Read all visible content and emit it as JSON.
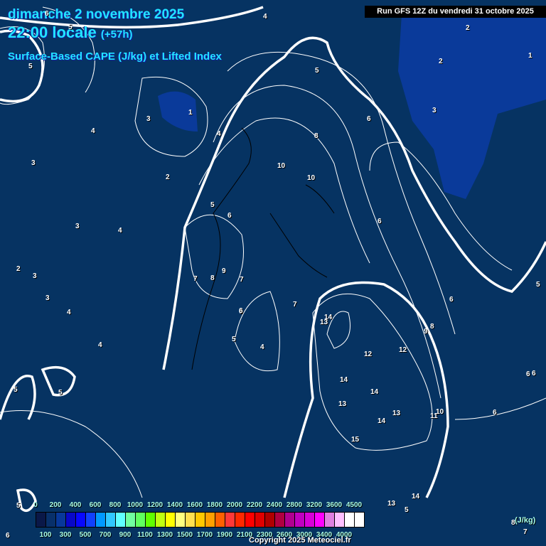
{
  "header": {
    "date": "dimanche 2 novembre 2025",
    "time": "22:00 locale",
    "lead": "(+57h)",
    "parameter": "Surface-Based CAPE (J/kg) et Lifted Index",
    "run": "Run GFS 12Z du vendredi 31 octobre 2025"
  },
  "map": {
    "background_color": "#063362",
    "low_cape_color": "#0a3a9a",
    "contour_labels": [
      "6",
      "5",
      "5",
      "4",
      "2",
      "1",
      "2",
      "3",
      "1",
      "3",
      "4",
      "3",
      "2",
      "3",
      "4",
      "3",
      "2",
      "3",
      "4",
      "4",
      "5",
      "5",
      "5",
      "5",
      "6",
      "4",
      "6",
      "8",
      "10",
      "10",
      "6",
      "5",
      "6",
      "7",
      "8",
      "9",
      "7",
      "6",
      "5",
      "4",
      "7",
      "14",
      "13",
      "12",
      "12",
      "14",
      "14",
      "13",
      "14",
      "13",
      "15",
      "11",
      "10",
      "8",
      "9",
      "6",
      "6",
      "6",
      "5",
      "6",
      "13",
      "14",
      "5",
      "6",
      "8",
      "7"
    ]
  },
  "legend": {
    "unit": "(J/kg)",
    "top_labels": [
      "0",
      "200",
      "400",
      "600",
      "800",
      "1000",
      "1200",
      "1400",
      "1600",
      "1800",
      "2000",
      "2200",
      "2400",
      "2800",
      "3200",
      "3600",
      "4500"
    ],
    "bottom_labels": [
      "100",
      "300",
      "500",
      "700",
      "900",
      "1100",
      "1300",
      "1500",
      "1700",
      "1900",
      "2100",
      "2300",
      "2600",
      "3000",
      "3400",
      "4000"
    ],
    "colors": [
      "#0a1848",
      "#08306a",
      "#08389a",
      "#0808c8",
      "#0808ff",
      "#1040ff",
      "#0098ff",
      "#30c8ff",
      "#60ffff",
      "#70ffa0",
      "#60ff60",
      "#60ff00",
      "#c0ff10",
      "#ffff00",
      "#ffff80",
      "#ffe050",
      "#ffc800",
      "#ffa000",
      "#ff6000",
      "#ff3838",
      "#ff2800",
      "#ff0000",
      "#e00000",
      "#b00000",
      "#b00040",
      "#b00090",
      "#c000c0",
      "#d800d8",
      "#ff00ff",
      "#e080e0",
      "#ffc0ff",
      "#ffffff",
      "#ffffff"
    ]
  },
  "copyright": "Copyright 2025 Meteociel.fr"
}
